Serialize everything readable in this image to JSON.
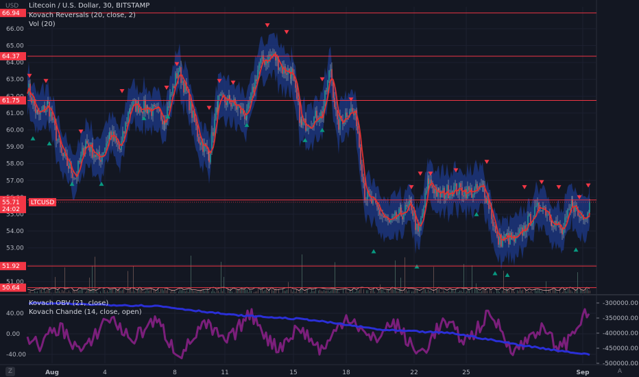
{
  "header": {
    "unit": "USD",
    "title": "Litecoin / U.S. Dollar, 30, BITSTAMP",
    "indicator1": "Kovach Reversals (20, close, 2)",
    "indicator2": "Vol (20)"
  },
  "price_axis": {
    "ticks": [
      "66.00",
      "65.00",
      "64.00",
      "63.00",
      "62.00",
      "61.00",
      "60.00",
      "59.00",
      "58.00",
      "57.00",
      "56.00",
      "55.00",
      "54.00",
      "53.00",
      "52.00",
      "51.00"
    ],
    "ticks_num": [
      66,
      65,
      64,
      63,
      62,
      61,
      60,
      59,
      58,
      57,
      56,
      55,
      54,
      53,
      52,
      51
    ]
  },
  "price_levels": {
    "values": [
      66.94,
      64.37,
      61.75,
      55.84,
      51.92,
      50.64
    ],
    "labels": [
      "66.94",
      "64.37",
      "61.75",
      "55.84",
      "51.92",
      "50.64"
    ],
    "color": "#f23645"
  },
  "current": {
    "label": "LTCUSD",
    "price_label": "55.71",
    "time_label": "24:02",
    "price": 55.71,
    "color": "#f23645"
  },
  "lower_pane": {
    "legend1": "Kovach OBV (21, close)",
    "legend2": "Kovach Chande (14, close, open)",
    "left_ticks": [
      "40.00",
      "0.00",
      "-40.00"
    ],
    "left_ticks_num": [
      40,
      0,
      -40
    ],
    "right_ticks": [
      "-300000.00",
      "-350000.00",
      "-400000.00",
      "-450000.00",
      "-500000.00"
    ],
    "right_ticks_num": [
      -300000,
      -350000,
      -400000,
      -450000,
      -500000
    ],
    "obv_color": "#2a2fd6",
    "chande_color": "#7b1f7b"
  },
  "time_axis": {
    "labels": [
      "Aug",
      "4",
      "8",
      "11",
      "15",
      "18",
      "22",
      "25",
      "Sep"
    ]
  },
  "corners": {
    "left_icon": "Z",
    "right_icon": "A"
  },
  "colors": {
    "background": "#131722",
    "candle_up": "#26a69a",
    "candle_down": "#ef5350",
    "band": "#1e3a8a",
    "signal_up": "#089981",
    "signal_down": "#f23645"
  },
  "chart_data": {
    "type": "line",
    "title": "Litecoin / U.S. Dollar, 30, BITSTAMP",
    "x": [
      "Aug",
      "4",
      "8",
      "11",
      "15",
      "18",
      "22",
      "25",
      "Sep"
    ],
    "series": [
      {
        "name": "LTCUSD",
        "values": [
          62.5,
          59.0,
          58.0,
          61.5,
          61.5,
          64.0,
          59.0,
          61.6,
          64.5,
          61.0,
          61.0,
          55.2,
          55.0,
          57.2,
          55.2,
          53.8,
          55.0,
          55.0,
          55.71
        ]
      }
    ],
    "ylim": [
      50.3,
      67.3
    ],
    "grid": true
  }
}
